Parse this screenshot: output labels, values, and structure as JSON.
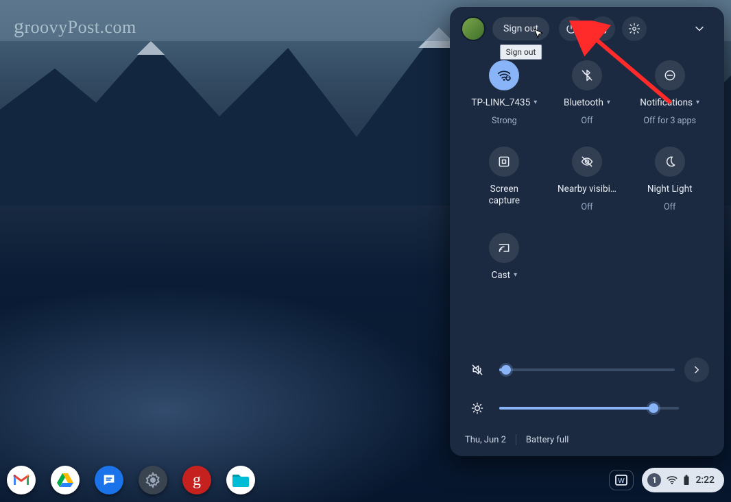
{
  "watermark": "groovyPost.com",
  "panel": {
    "signout_label": "Sign out",
    "tooltip": "Sign out",
    "tiles": [
      {
        "id": "wifi",
        "label": "TP-LINK_7435",
        "sub": "Strong",
        "active": true,
        "hasDropdown": true
      },
      {
        "id": "bluetooth",
        "label": "Bluetooth",
        "sub": "Off",
        "active": false,
        "hasDropdown": true
      },
      {
        "id": "notifications",
        "label": "Notifications",
        "sub": "Off for 3 apps",
        "active": false,
        "hasDropdown": true
      },
      {
        "id": "screencap",
        "label": "Screen capture",
        "sub": "",
        "active": false,
        "hasDropdown": false,
        "twoLine": true
      },
      {
        "id": "nearby",
        "label": "Nearby visibi…",
        "sub": "Off",
        "active": false,
        "hasDropdown": false
      },
      {
        "id": "nightlight",
        "label": "Night Light",
        "sub": "Off",
        "active": false,
        "hasDropdown": false
      },
      {
        "id": "cast",
        "label": "Cast",
        "sub": "",
        "active": false,
        "hasDropdown": true
      }
    ],
    "sliders": {
      "volume_pct": 4,
      "brightness_pct": 86
    },
    "footer": {
      "date": "Thu, Jun 2",
      "battery": "Battery full"
    }
  },
  "shelf": {
    "ime": "W",
    "status": {
      "notif_count": "1",
      "time": "2:22"
    },
    "apps": [
      {
        "id": "gmail",
        "name": "Gmail"
      },
      {
        "id": "drive",
        "name": "Google Drive"
      },
      {
        "id": "messages",
        "name": "Messages"
      },
      {
        "id": "settings",
        "name": "Settings"
      },
      {
        "id": "groovy",
        "name": "groovyPost"
      },
      {
        "id": "files",
        "name": "Files"
      }
    ]
  }
}
